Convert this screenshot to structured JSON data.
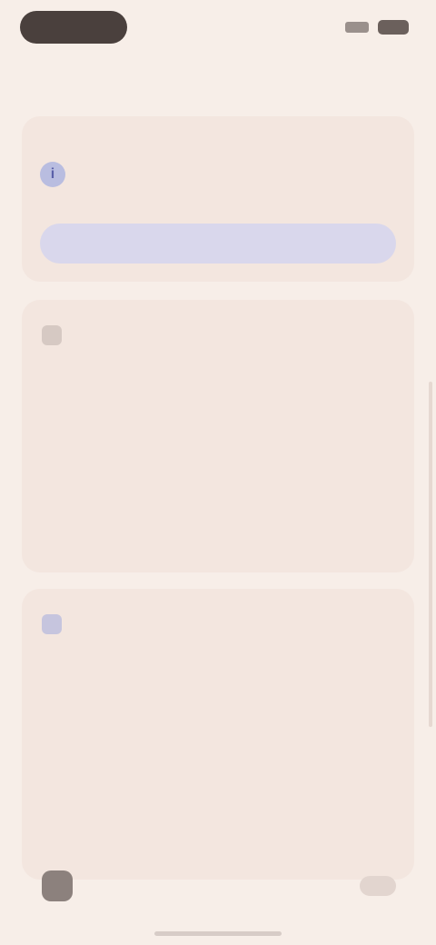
{
  "header": {
    "title": ""
  },
  "info_card": {
    "icon": "info-icon",
    "title": "",
    "subtitle": "",
    "button_label": ""
  },
  "description": {
    "icon": "description-icon",
    "label": "",
    "text": ""
  },
  "details": {
    "icon": "details-icon",
    "label": "",
    "fields": [
      {
        "key": "",
        "value": ""
      },
      {
        "key": "",
        "value": ""
      },
      {
        "key": "",
        "value": ""
      }
    ]
  }
}
